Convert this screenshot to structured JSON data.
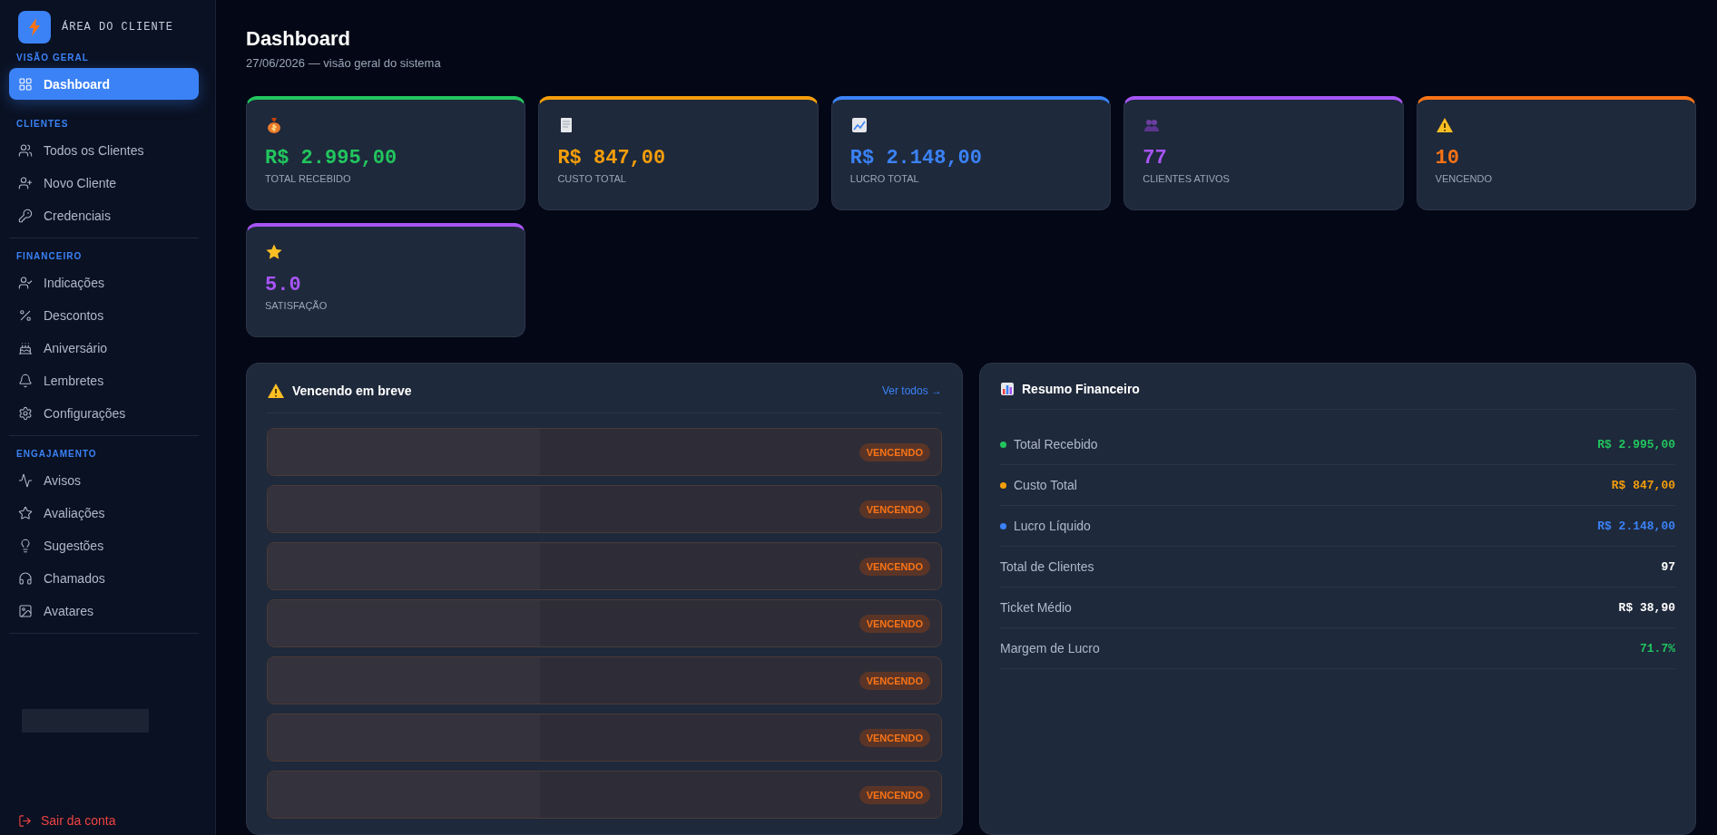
{
  "brand": {
    "title": "ÁREA DO CLIENTE"
  },
  "sidebar": {
    "sections": [
      {
        "title": "VISÃO GERAL",
        "items": [
          {
            "label": "Dashboard",
            "selected": true
          }
        ]
      },
      {
        "title": "CLIENTES",
        "items": [
          {
            "label": "Todos os Clientes",
            "selected": false
          },
          {
            "label": "Novo Cliente",
            "selected": false
          },
          {
            "label": "Credenciais",
            "selected": false
          }
        ]
      },
      {
        "title": "FINANCEIRO",
        "items": [
          {
            "label": "Indicações",
            "selected": false
          },
          {
            "label": "Descontos",
            "selected": false
          },
          {
            "label": "Aniversário",
            "selected": false
          },
          {
            "label": "Lembretes",
            "selected": false
          },
          {
            "label": "Configurações",
            "selected": false
          }
        ]
      },
      {
        "title": "ENGAJAMENTO",
        "items": [
          {
            "label": "Avisos",
            "selected": false
          },
          {
            "label": "Avaliações",
            "selected": false
          },
          {
            "label": "Sugestões",
            "selected": false
          },
          {
            "label": "Chamados",
            "selected": false
          },
          {
            "label": "Avatares",
            "selected": false
          }
        ]
      }
    ],
    "logout": "Sair da conta"
  },
  "header": {
    "title": "Dashboard",
    "subtitle": "27/06/2026 — visão geral do sistema"
  },
  "stats": [
    {
      "value": "R$ 2.995,00",
      "label": "TOTAL RECEBIDO",
      "color": "#22c55e"
    },
    {
      "value": "R$ 847,00",
      "label": "CUSTO TOTAL",
      "color": "#f59e0b"
    },
    {
      "value": "R$ 2.148,00",
      "label": "LUCRO TOTAL",
      "color": "#3b82f6"
    },
    {
      "value": "77",
      "label": "CLIENTES ATIVOS",
      "color": "#a855f7"
    },
    {
      "value": "10",
      "label": "VENCENDO",
      "color": "#f97316"
    },
    {
      "value": "5.0",
      "label": "SATISFAÇÃO",
      "color": "#a855f7"
    }
  ],
  "expiring": {
    "title": "Vencendo em breve",
    "link": "Ver todos →",
    "rows": [
      {
        "badge": "VENCENDO"
      },
      {
        "badge": "VENCENDO"
      },
      {
        "badge": "VENCENDO"
      },
      {
        "badge": "VENCENDO"
      },
      {
        "badge": "VENCENDO"
      },
      {
        "badge": "VENCENDO"
      },
      {
        "badge": "VENCENDO"
      }
    ]
  },
  "summary": {
    "title": "Resumo Financeiro",
    "rows": [
      {
        "label": "Total Recebido",
        "value": "R$ 2.995,00",
        "dot": true,
        "color": "#22c55e"
      },
      {
        "label": "Custo Total",
        "value": "R$ 847,00",
        "dot": true,
        "color": "#f59e0b"
      },
      {
        "label": "Lucro Líquido",
        "value": "R$ 2.148,00",
        "dot": true,
        "color": "#3b82f6"
      },
      {
        "label": "Total de Clientes",
        "value": "97",
        "dot": false,
        "color": "#ffffff"
      },
      {
        "label": "Ticket Médio",
        "value": "R$ 38,90",
        "dot": false,
        "color": "#ffffff"
      },
      {
        "label": "Margem de Lucro",
        "value": "71.7%",
        "dot": false,
        "color": "#22c55e"
      }
    ]
  }
}
